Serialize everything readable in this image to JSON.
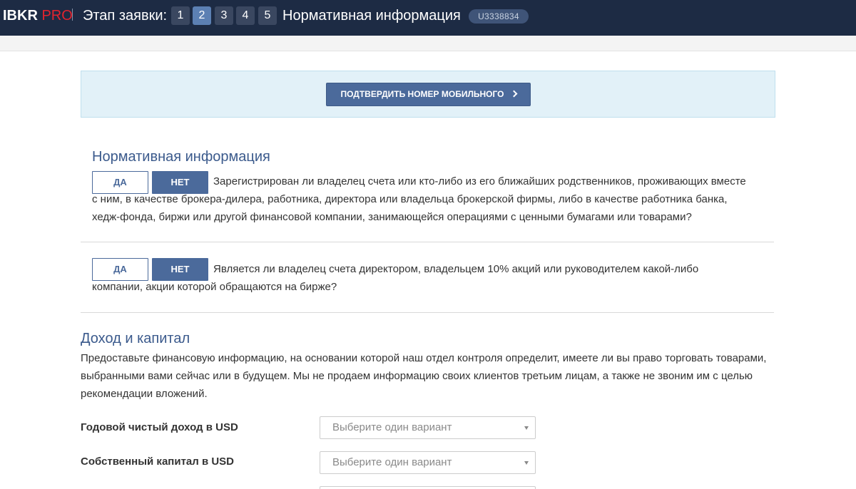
{
  "header": {
    "logo_main": "IBKR",
    "logo_pro": "PRO",
    "stage_label": "Этап заявки:",
    "steps": [
      "1",
      "2",
      "3",
      "4",
      "5"
    ],
    "active_step": "2",
    "title": "Нормативная информация",
    "account_id": "U3338834"
  },
  "confirm": {
    "button_label": "ПОДТВЕРДИТЬ НОМЕР МОБИЛЬНОГО"
  },
  "regulatory": {
    "title": "Нормативная информация",
    "questions": [
      {
        "yes_label": "ДА",
        "no_label": "НЕТ",
        "selected": "НЕТ",
        "text": "Зарегистрирован ли владелец счета или кто-либо из его ближайших родственников, проживающих вместе с ним, в качестве брокера-дилера, работника, директора или владельца брокерской фирмы, либо в качестве работника банка, хедж-фонда, биржи или другой финансовой компании, занимающейся операциями с ценными бумагами или товарами?"
      },
      {
        "yes_label": "ДА",
        "no_label": "НЕТ",
        "selected": "НЕТ",
        "text": "Является ли владелец счета директором, владельцем 10% акций или руководителем какой-либо компании, акции которой обращаются на бирже?"
      }
    ]
  },
  "income": {
    "title": "Доход и капитал",
    "intro": "Предоставьте финансовую информацию, на основании которой наш отдел контроля определит, имеете ли вы право торговать товарами, выбранными вами сейчас или в будущем. Мы не продаем информацию своих клиентов третьим лицам, а также не звоним им с целью рекомендации вложений.",
    "fields": [
      {
        "label": "Годовой чистый доход в USD",
        "placeholder": "Выберите один вариант"
      },
      {
        "label": "Собственный капитал в USD",
        "placeholder": "Выберите один вариант"
      }
    ]
  },
  "colors": {
    "header_bg": "#1d2b44",
    "brand_red": "#e3232e",
    "accent_blue": "#4b6a9b",
    "section_title": "#3b5a8c",
    "panel_bg": "#e2f1f8"
  }
}
